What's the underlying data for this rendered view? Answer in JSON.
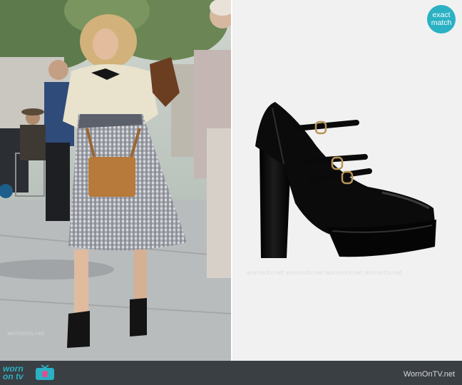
{
  "badge": {
    "line1": "exact",
    "line2": "match"
  },
  "footer": {
    "logo_top": "worn",
    "logo_bottom": "on tv",
    "site": "WornOnTV.net"
  }
}
